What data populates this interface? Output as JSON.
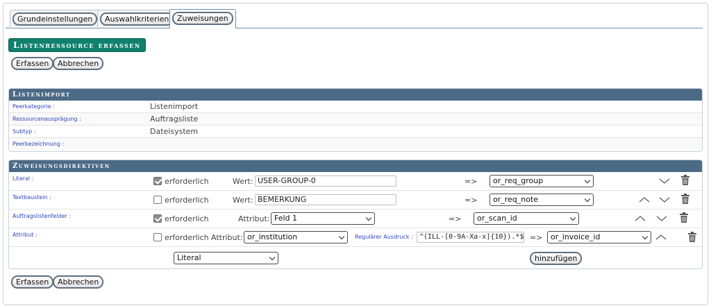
{
  "tabs": [
    {
      "label": "Grundeinstellungen",
      "active": false
    },
    {
      "label": "Auswahlkriterien",
      "active": false
    },
    {
      "label": "Zuweisungen",
      "active": true
    }
  ],
  "page_title": "Listenressource erfassen",
  "actions": {
    "submit_label": "Erfassen",
    "cancel_label": "Abbrechen"
  },
  "listenimport": {
    "title": "Listenimport",
    "rows": [
      {
        "key": "Peerkategorie :",
        "value": "Listenimport"
      },
      {
        "key": "Ressourcenausprägung :",
        "value": "Auftragsliste"
      },
      {
        "key": "Subtyp :",
        "value": "Dateisystem"
      },
      {
        "key": "Peerbezeichnung :",
        "value": ""
      }
    ]
  },
  "zuweisungen": {
    "title": "Zuweisungsdirektiven",
    "required_label": "erforderlich",
    "value_label": "Wert:",
    "attribute_label": "Attribut:",
    "regex_label": "Regulärer Ausdruck :",
    "arrow": "=>",
    "rows": [
      {
        "key": "Literal :",
        "required": true,
        "value": "USER-GROUP-0",
        "target": "or_req_group"
      },
      {
        "key": "Textbaustein :",
        "required": false,
        "value": "BEMERKUNG",
        "target": "or_req_note"
      },
      {
        "key": "Auftragslistenfelder :",
        "required": true,
        "attribute": "Feld 1",
        "target": "or_scan_id"
      },
      {
        "key": "Attribut :",
        "required": false,
        "attribute": "or_institution",
        "regex": "^(ILL-[0-9A-Xa-x]{10}).*$",
        "target": "or_invoice_id"
      }
    ],
    "new_type": "Literal",
    "add_label": "hinzufügen"
  }
}
